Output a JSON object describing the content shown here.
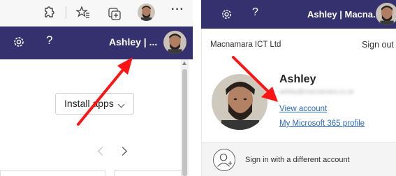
{
  "left_panel": {
    "browser_icons": [
      "extensions-icon",
      "favorites-icon",
      "collections-icon",
      "profile-avatar",
      "more-icon"
    ],
    "more_label": "···",
    "suite_bar": {
      "user_name": "Ashley | ...",
      "help_label": "?"
    },
    "install_button_label": "Install apps"
  },
  "right_panel": {
    "suite_bar": {
      "user_name": "Ashley | Macna...",
      "help_label": "?"
    },
    "account_card": {
      "organization": "Macnamara ICT Ltd",
      "sign_out_label": "Sign out",
      "display_name": "Ashley",
      "email_blurred": "ashley@macnamara.co.uk",
      "view_account_label": "View account",
      "profile_link_label": "My Microsoft 365 profile",
      "other_account_label": "Sign in with a different account"
    }
  },
  "colors": {
    "suite_bar": "#35316f",
    "link": "#2d6bc4",
    "annotation_arrow": "#ff1414"
  }
}
